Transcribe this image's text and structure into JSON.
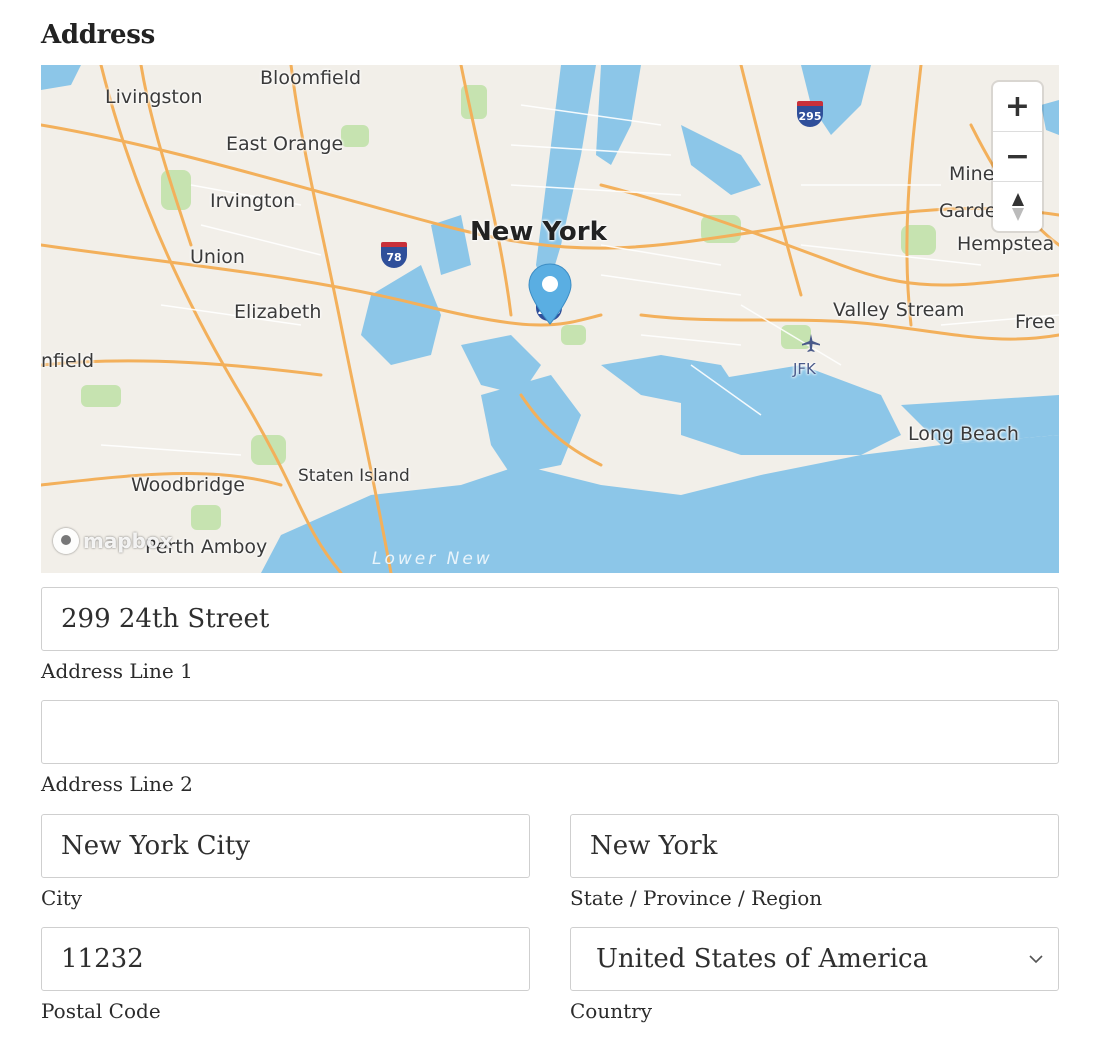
{
  "section": {
    "title": "Address"
  },
  "map": {
    "places": {
      "bloomfield": "Bloomfield",
      "livingston": "Livingston",
      "east_orange": "East Orange",
      "irvington": "Irvington",
      "union": "Union",
      "elizabeth": "Elizabeth",
      "plainfield": "nfield",
      "woodbridge": "Woodbridge",
      "perth_amboy": "Perth Amboy",
      "staten_island": "Staten Island",
      "new_york": "New York",
      "valley_stream": "Valley Stream",
      "freeport": "Free",
      "jfk": "JFK",
      "long_beach": "Long Beach",
      "mineola": "Mine",
      "garden_city": "Garde    ty",
      "hempstead": "Hempstea",
      "lower_bay": "Lower New"
    },
    "shields": {
      "i295": "295",
      "i78": "78",
      "i278": "278"
    },
    "zoom_in_label": "+",
    "zoom_out_label": "−",
    "attribution_logo": "mapbox",
    "colors": {
      "water": "#8cc6e8",
      "land": "#f2efe9",
      "roads": "#f3b05b",
      "parks": "#c6e3b0",
      "pin": "#5aaee2"
    }
  },
  "form": {
    "address_line1": {
      "value": "299 24th Street",
      "label": "Address Line 1"
    },
    "address_line2": {
      "value": "",
      "label": "Address Line 2"
    },
    "city": {
      "value": "New York City",
      "label": "City"
    },
    "state": {
      "value": "New York",
      "label": "State / Province / Region"
    },
    "postal_code": {
      "value": "11232",
      "label": "Postal Code"
    },
    "country": {
      "value": "United States of America",
      "label": "Country"
    }
  }
}
